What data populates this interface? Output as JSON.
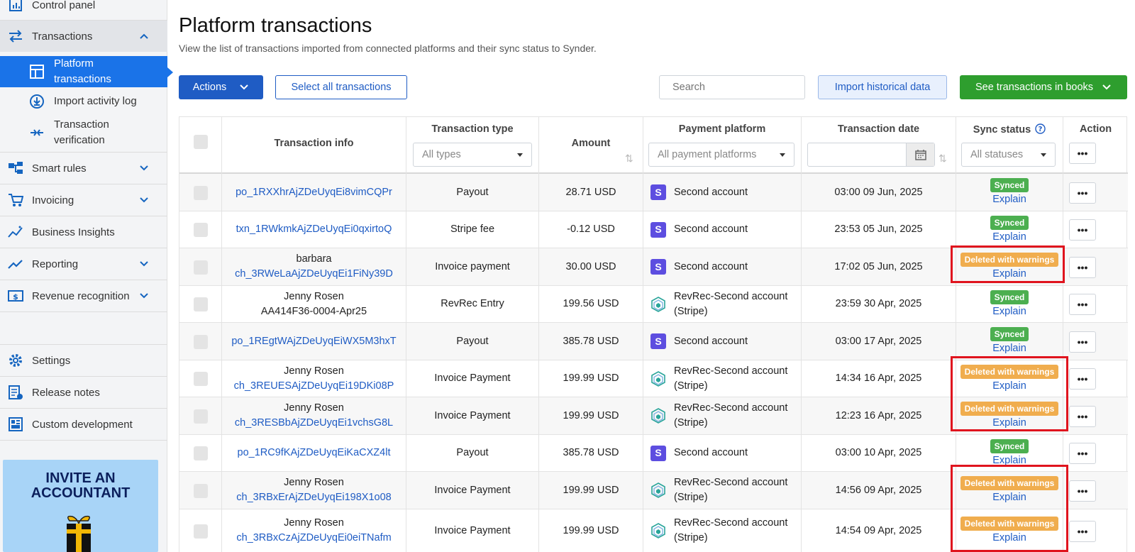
{
  "sidebar": {
    "control_panel": "Control panel",
    "transactions": "Transactions",
    "sub": {
      "platform_transactions": "Platform\ntransactions",
      "import_log": "Import activity log",
      "verification": "Transaction\nverification"
    },
    "smart_rules": "Smart rules",
    "invoicing": "Invoicing",
    "business_insights": "Business Insights",
    "reporting": "Reporting",
    "revenue_recognition": "Revenue recognition",
    "settings": "Settings",
    "release_notes": "Release notes",
    "custom_development": "Custom development",
    "banner": {
      "line1": "INVITE AN",
      "line2": "ACCOUNTANT"
    }
  },
  "header": {
    "title": "Platform transactions",
    "subtitle": "View the list of transactions imported from connected platforms and their sync status to Synder."
  },
  "toolbar": {
    "actions": "Actions",
    "select_all": "Select all transactions",
    "search_placeholder": "Search",
    "import_historical": "Import historical data",
    "see_in_books": "See transactions in books"
  },
  "table": {
    "headers": {
      "info": "Transaction info",
      "type": "Transaction type",
      "amount": "Amount",
      "platform": "Payment platform",
      "date": "Transaction date",
      "sync": "Sync status",
      "action": "Action"
    },
    "filters": {
      "type": "All types",
      "platform": "All payment platforms",
      "status": "All statuses"
    },
    "rows": [
      {
        "name": "",
        "id": "po_1RXXhrAjZDeUyqEi8vimCQPr",
        "type": "Payout",
        "amount": "28.71 USD",
        "platform": "Second account",
        "platform2": "",
        "date": "03:00 09 Jun, 2025",
        "status": "Synced",
        "explain": "Explain"
      },
      {
        "name": "",
        "id": "txn_1RWkmkAjZDeUyqEi0qxirtoQ",
        "type": "Stripe fee",
        "amount": "-0.12 USD",
        "platform": "Second account",
        "platform2": "",
        "date": "23:53 05 Jun, 2025",
        "status": "Synced",
        "explain": "Explain"
      },
      {
        "name": "barbara",
        "id": "ch_3RWeLaAjZDeUyqEi1FiNy39D",
        "type": "Invoice payment",
        "amount": "30.00 USD",
        "platform": "Second account",
        "platform2": "",
        "date": "17:02 05 Jun, 2025",
        "status": "Deleted with warnings",
        "explain": "Explain"
      },
      {
        "name": "Jenny Rosen",
        "id": "AA414F36-0004-Apr25",
        "type": "RevRec Entry",
        "amount": "199.56 USD",
        "platform": "RevRec-Second account",
        "platform2": "(Stripe)",
        "date": "23:59 30 Apr, 2025",
        "status": "Synced",
        "explain": "Explain"
      },
      {
        "name": "",
        "id": "po_1REgtWAjZDeUyqEiWX5M3hxT",
        "type": "Payout",
        "amount": "385.78 USD",
        "platform": "Second account",
        "platform2": "",
        "date": "03:00 17 Apr, 2025",
        "status": "Synced",
        "explain": "Explain"
      },
      {
        "name": "Jenny Rosen",
        "id": "ch_3REUESAjZDeUyqEi19DKi08P",
        "type": "Invoice Payment",
        "amount": "199.99 USD",
        "platform": "RevRec-Second account",
        "platform2": "(Stripe)",
        "date": "14:34 16 Apr, 2025",
        "status": "Deleted with warnings",
        "explain": "Explain"
      },
      {
        "name": "Jenny Rosen",
        "id": "ch_3RESBbAjZDeUyqEi1vchsG8L",
        "type": "Invoice Payment",
        "amount": "199.99 USD",
        "platform": "RevRec-Second account",
        "platform2": "(Stripe)",
        "date": "12:23 16 Apr, 2025",
        "status": "Deleted with warnings",
        "explain": "Explain"
      },
      {
        "name": "",
        "id": "po_1RC9fKAjZDeUyqEiKaCXZ4lt",
        "type": "Payout",
        "amount": "385.78 USD",
        "platform": "Second account",
        "platform2": "",
        "date": "03:00 10 Apr, 2025",
        "status": "Synced",
        "explain": "Explain"
      },
      {
        "name": "Jenny Rosen",
        "id": "ch_3RBxErAjZDeUyqEi198X1o08",
        "type": "Invoice Payment",
        "amount": "199.99 USD",
        "platform": "RevRec-Second account",
        "platform2": "(Stripe)",
        "date": "14:56 09 Apr, 2025",
        "status": "Deleted with warnings",
        "explain": "Explain"
      },
      {
        "name": "Jenny Rosen",
        "id": "ch_3RBxCzAjZDeUyqEi0eiTNafm",
        "type": "Invoice Payment",
        "amount": "199.99 USD",
        "platform": "RevRec-Second account",
        "platform2": "(Stripe)",
        "date": "14:54 09 Apr, 2025",
        "status": "Deleted with warnings",
        "explain": "Explain"
      }
    ]
  },
  "colors": {
    "accent": "#1f5cc4",
    "synced": "#4caf50",
    "deleted": "#f0ad4e",
    "highlight": "#e0141e"
  },
  "icons": {
    "stripe": "stripe-s-icon",
    "revrec": "revrec-cube-icon"
  }
}
